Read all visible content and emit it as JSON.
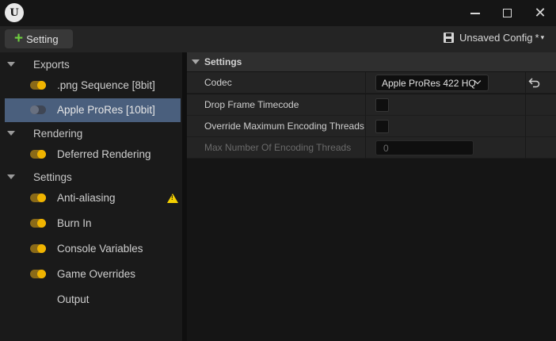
{
  "titlebar": {
    "logo_letter": "U",
    "minimize_label": "minimize",
    "maximize_label": "maximize",
    "close_glyph": "✕"
  },
  "toolbar": {
    "add_icon": "+",
    "add_setting_label": "Setting",
    "config_name": "Unsaved Config",
    "config_dirty_marker": "*",
    "config_caret": "▾"
  },
  "left_panel": {
    "groups": [
      {
        "label": "Exports",
        "items": [
          {
            "label": ".png Sequence [8bit]",
            "enabled": true,
            "selected": false
          },
          {
            "label": "Apple ProRes [10bit]",
            "enabled": false,
            "selected": true
          }
        ]
      },
      {
        "label": "Rendering",
        "items": [
          {
            "label": "Deferred Rendering",
            "enabled": true,
            "selected": false
          }
        ]
      },
      {
        "label": "Settings",
        "items": [
          {
            "label": "Anti-aliasing",
            "enabled": true,
            "selected": false,
            "warning": true
          },
          {
            "label": "Burn In",
            "enabled": true,
            "selected": false
          },
          {
            "label": "Console Variables",
            "enabled": true,
            "selected": false
          },
          {
            "label": "Game Overrides",
            "enabled": true,
            "selected": false
          },
          {
            "label": "Output",
            "enabled": null,
            "selected": false
          }
        ]
      }
    ],
    "warning_glyph": "!"
  },
  "details": {
    "category": "Settings",
    "properties": [
      {
        "name": "Codec",
        "type": "combo",
        "value": "Apple ProRes 422 HQ",
        "has_reset": true
      },
      {
        "name": "Drop Frame Timecode",
        "type": "checkbox",
        "checked": false
      },
      {
        "name": "Override Maximum Encoding Threads",
        "type": "checkbox",
        "checked": false
      },
      {
        "name": "Max Number Of Encoding Threads",
        "type": "number",
        "value": "0",
        "disabled": true
      }
    ]
  },
  "colors": {
    "accent_selected": "#4a5f7d",
    "toggle_on": "#f0b400",
    "add_green": "#6fcf3f",
    "warning_yellow": "#f5d000"
  },
  "icons": [
    "unreal-logo-icon",
    "minimize-icon",
    "maximize-icon",
    "close-icon",
    "plus-icon",
    "save-icon",
    "chevron-down-icon",
    "toggle-icon",
    "warning-icon",
    "reset-to-default-icon",
    "expand-arrow-icon"
  ]
}
